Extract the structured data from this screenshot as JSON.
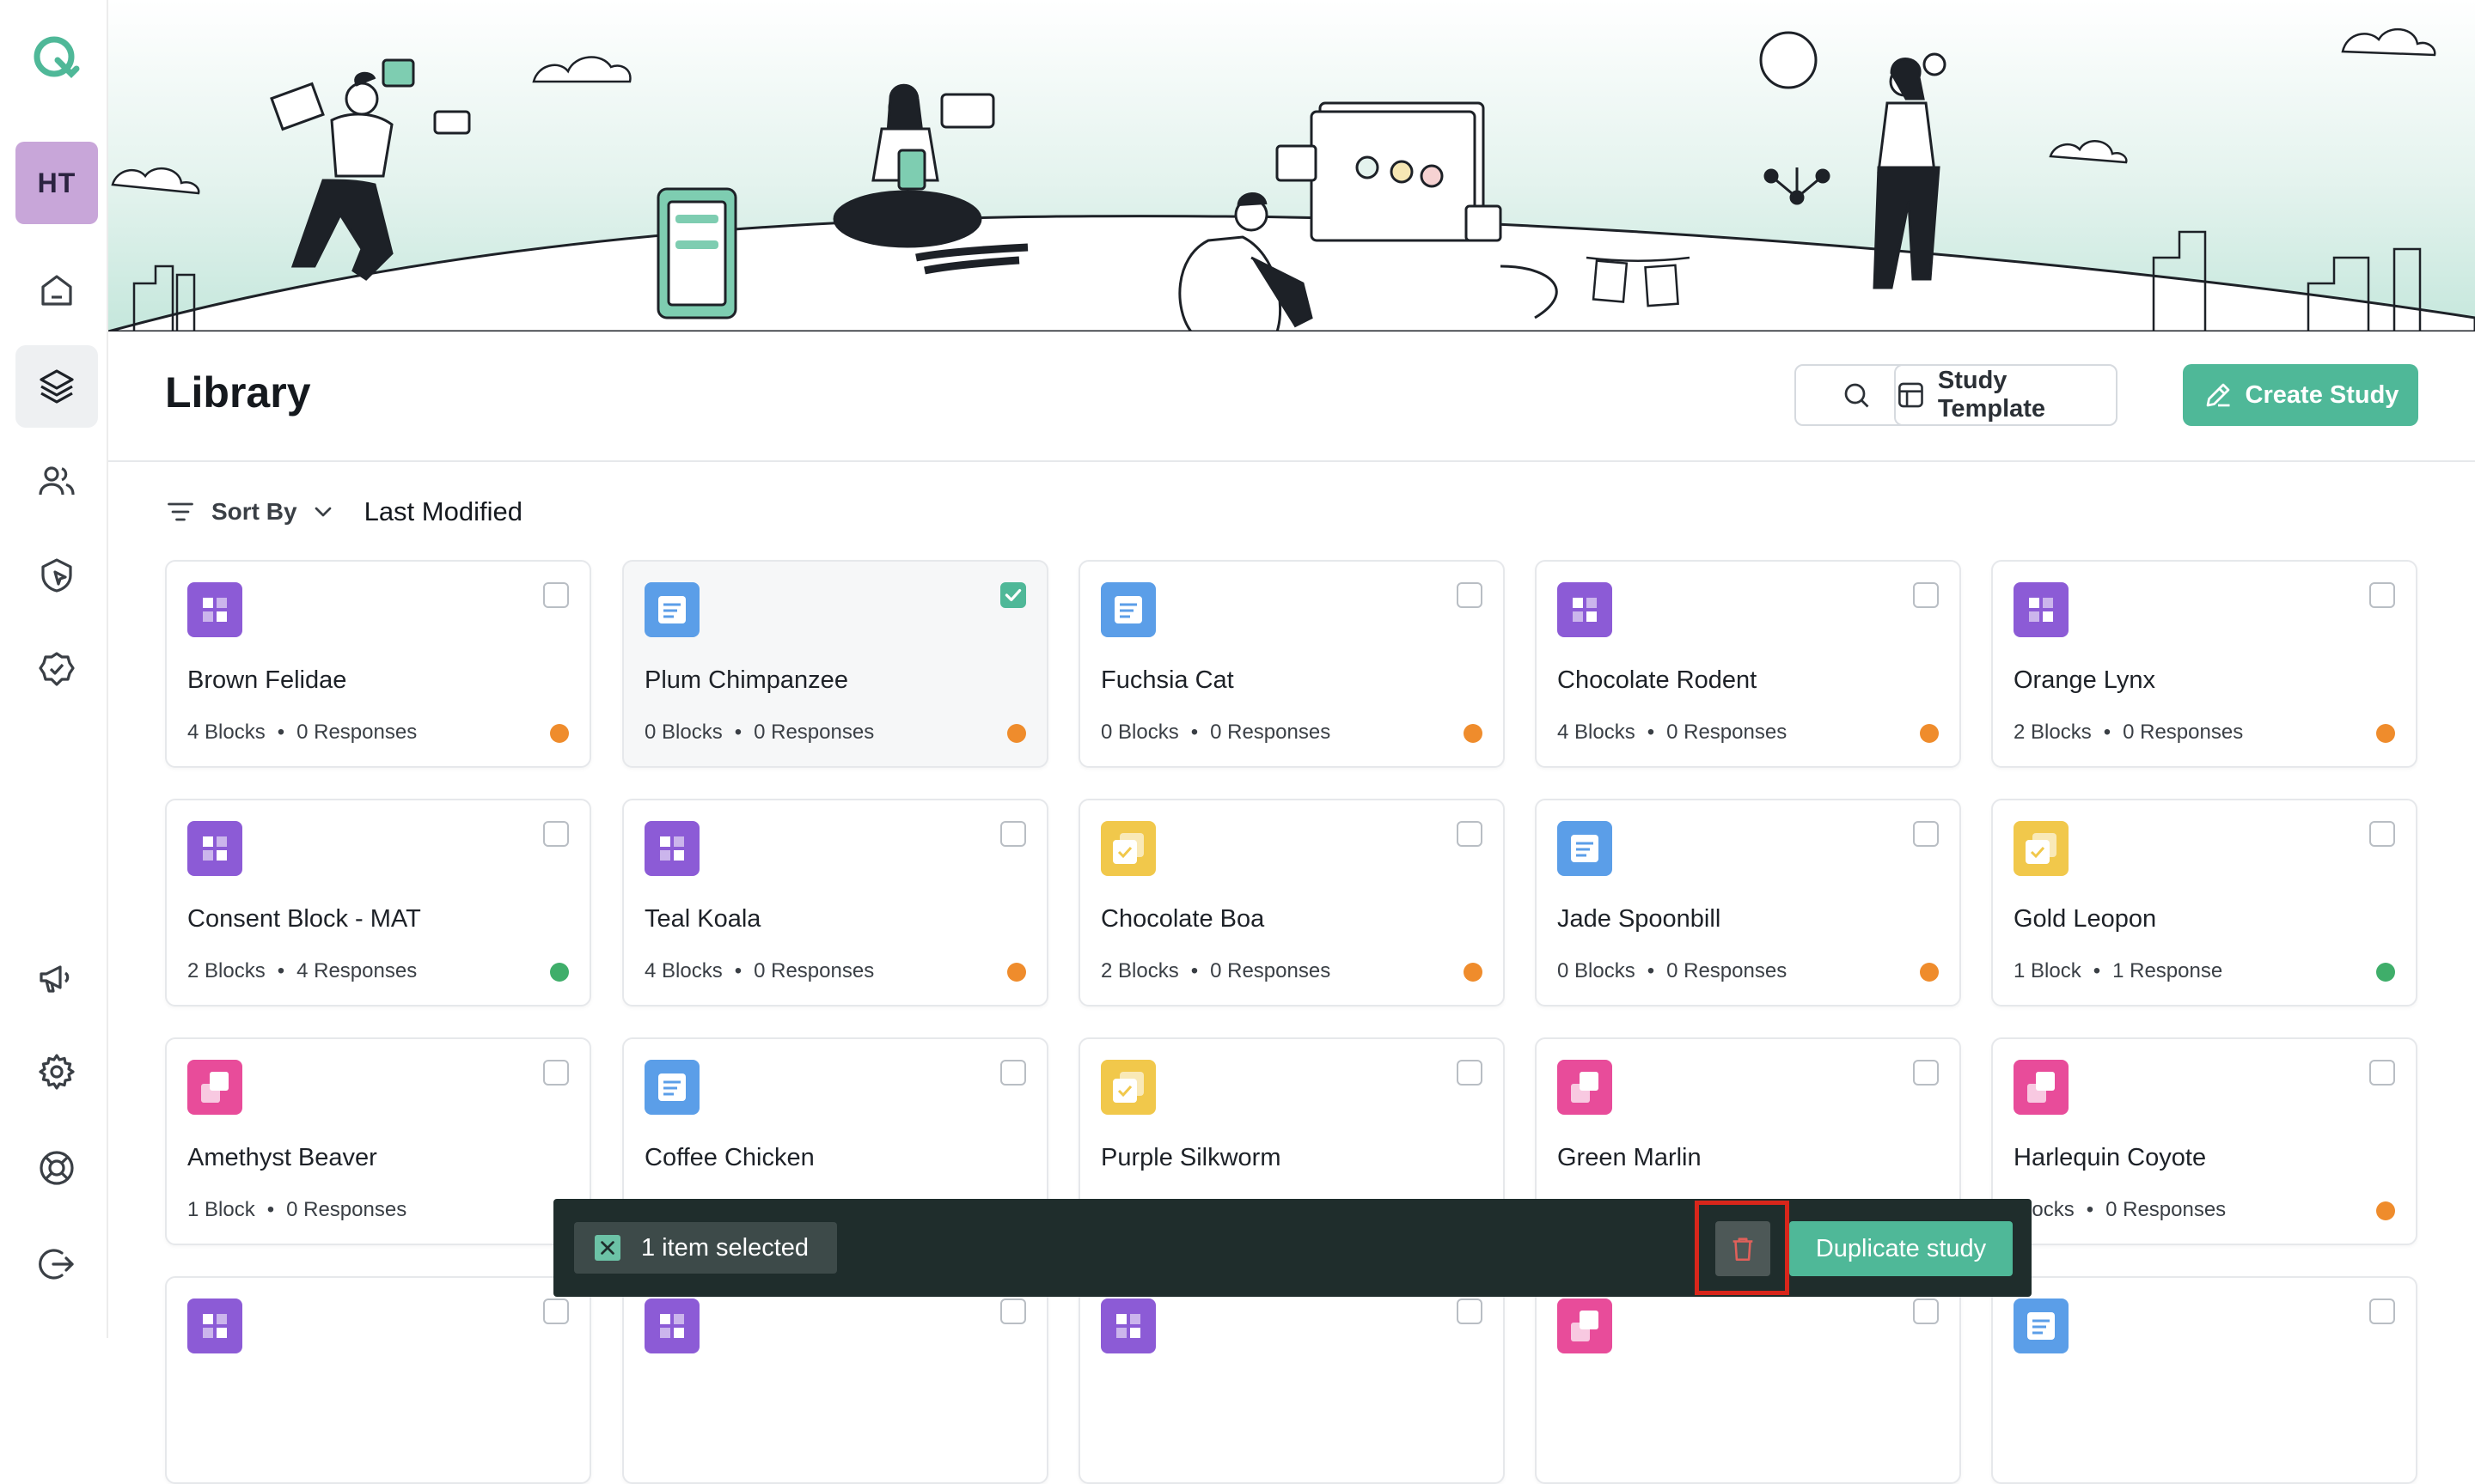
{
  "sidebar": {
    "avatar_initials": "HT",
    "items": [
      {
        "name": "home-icon"
      },
      {
        "name": "library-layers-icon",
        "active": true
      },
      {
        "name": "users-icon"
      },
      {
        "name": "cursor-click-icon"
      },
      {
        "name": "check-badge-icon"
      },
      {
        "name": "megaphone-icon"
      },
      {
        "name": "gear-icon"
      },
      {
        "name": "lifebuoy-icon"
      },
      {
        "name": "logout-icon"
      }
    ]
  },
  "header": {
    "title": "Library",
    "search_icon": "search-icon",
    "template_label": "Study Template",
    "create_label": "Create Study"
  },
  "sort": {
    "label": "Sort By",
    "value": "Last Modified"
  },
  "colors": {
    "accent": "#4fb898",
    "status_orange": "#ef8c2c",
    "status_green": "#3fae6a",
    "icon_purple": "#8c5bd6",
    "icon_blue": "#5b9ee8",
    "icon_yellow": "#f1c84b",
    "icon_pink": "#e84c9a"
  },
  "cards": [
    {
      "title": "Brown Felidae",
      "blocks": "4 Blocks",
      "responses": "0 Responses",
      "icon": "purple",
      "status": "orange",
      "checked": false
    },
    {
      "title": "Plum Chimpanzee",
      "blocks": "0 Blocks",
      "responses": "0 Responses",
      "icon": "blue",
      "status": "orange",
      "checked": true
    },
    {
      "title": "Fuchsia Cat",
      "blocks": "0 Blocks",
      "responses": "0 Responses",
      "icon": "blue",
      "status": "orange",
      "checked": false
    },
    {
      "title": "Chocolate Rodent",
      "blocks": "4 Blocks",
      "responses": "0 Responses",
      "icon": "purple",
      "status": "orange",
      "checked": false
    },
    {
      "title": "Orange Lynx",
      "blocks": "2 Blocks",
      "responses": "0 Responses",
      "icon": "purple",
      "status": "orange",
      "checked": false
    },
    {
      "title": "Consent Block - MAT",
      "blocks": "2 Blocks",
      "responses": "4 Responses",
      "icon": "purple",
      "status": "green",
      "checked": false
    },
    {
      "title": "Teal Koala",
      "blocks": "4 Blocks",
      "responses": "0 Responses",
      "icon": "purple",
      "status": "orange",
      "checked": false
    },
    {
      "title": "Chocolate Boa",
      "blocks": "2 Blocks",
      "responses": "0 Responses",
      "icon": "yellow",
      "status": "orange",
      "checked": false
    },
    {
      "title": "Jade Spoonbill",
      "blocks": "0 Blocks",
      "responses": "0 Responses",
      "icon": "blue",
      "status": "orange",
      "checked": false
    },
    {
      "title": "Gold Leopon",
      "blocks": "1 Block",
      "responses": "1 Response",
      "icon": "yellow",
      "status": "green",
      "checked": false
    },
    {
      "title": "Amethyst Beaver",
      "blocks": "1 Block",
      "responses": "0 Responses",
      "icon": "pink",
      "status": "none",
      "checked": false
    },
    {
      "title": "Coffee Chicken",
      "blocks": "",
      "responses": "",
      "icon": "blue",
      "status": "none",
      "checked": false
    },
    {
      "title": "Purple Silkworm",
      "blocks": "",
      "responses": "",
      "icon": "yellow",
      "status": "none",
      "checked": false
    },
    {
      "title": "Green Marlin",
      "blocks": "",
      "responses": "",
      "icon": "pink",
      "status": "none",
      "checked": false
    },
    {
      "title": "Harlequin Coyote",
      "blocks": "Blocks",
      "responses": "0 Responses",
      "icon": "pink",
      "status": "orange",
      "checked": false
    },
    {
      "title": "",
      "blocks": "",
      "responses": "",
      "icon": "purple",
      "status": "none",
      "checked": false
    },
    {
      "title": "",
      "blocks": "",
      "responses": "",
      "icon": "purple",
      "status": "none",
      "checked": false
    },
    {
      "title": "",
      "blocks": "",
      "responses": "",
      "icon": "purple",
      "status": "none",
      "checked": false
    },
    {
      "title": "",
      "blocks": "",
      "responses": "",
      "icon": "pink",
      "status": "none",
      "checked": false
    },
    {
      "title": "",
      "blocks": "",
      "responses": "",
      "icon": "blue",
      "status": "none",
      "checked": false
    }
  ],
  "selection_bar": {
    "count_text": "1 item selected",
    "delete_icon": "trash-icon",
    "duplicate_label": "Duplicate study"
  }
}
